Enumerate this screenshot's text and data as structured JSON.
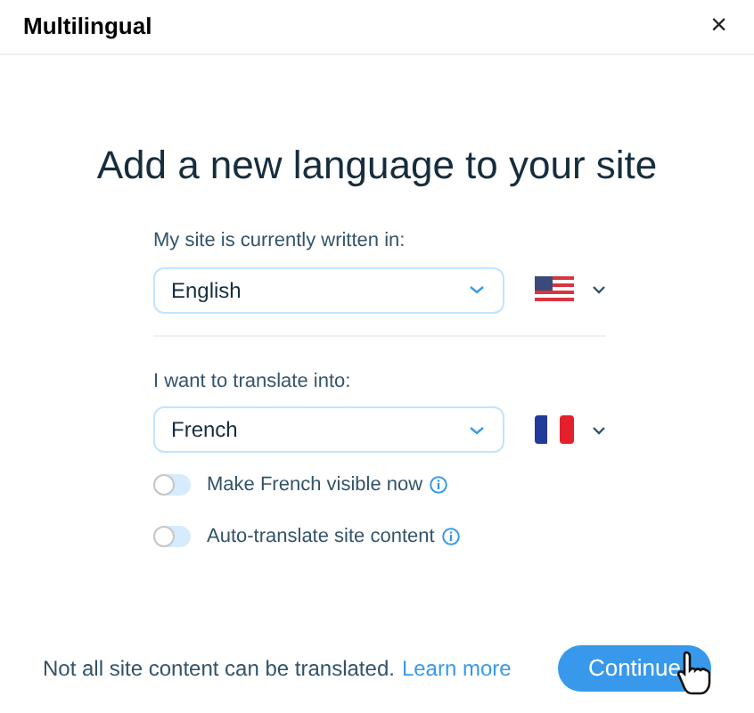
{
  "window": {
    "title": "Multilingual",
    "close": "×"
  },
  "heading": "Add a new language to your site",
  "languages": [
    {
      "label": "My site is currently written in:",
      "value": "English"
    },
    {
      "label": "I want to translate into:",
      "value": "French"
    }
  ],
  "toggles": [
    {
      "label": "Make French visible now",
      "on": false
    },
    {
      "label": "Auto-translate site content",
      "on": false
    }
  ],
  "footer": {
    "note": "Not all site content can be translated.",
    "link": "Learn more",
    "button": "Continue"
  }
}
